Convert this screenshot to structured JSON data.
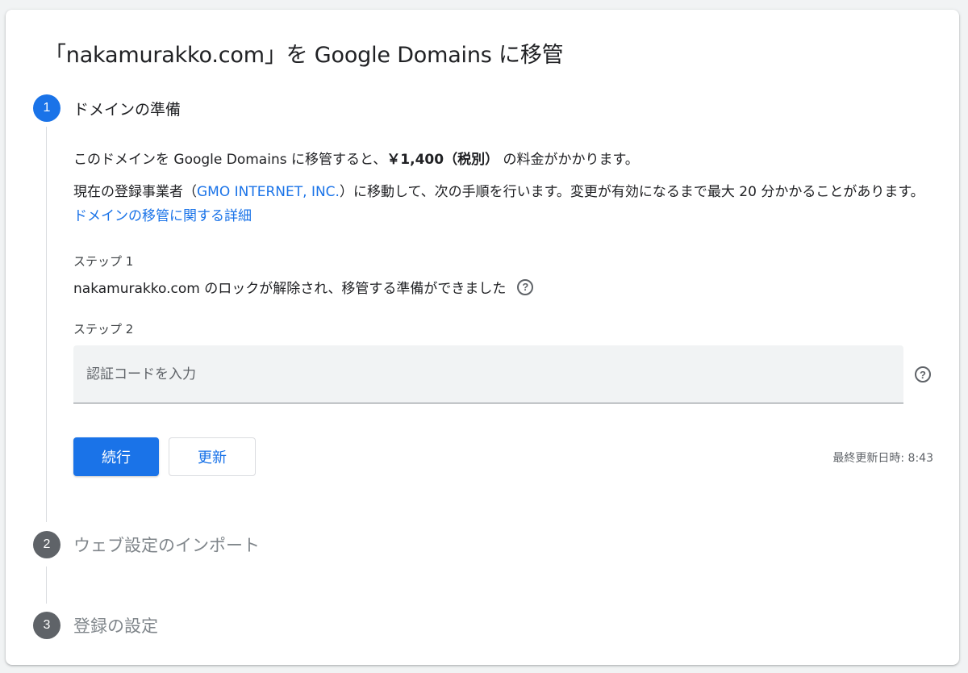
{
  "title": "「nakamurakko.com」を Google Domains に移管",
  "steps": [
    {
      "number": "1",
      "label": "ドメインの準備"
    },
    {
      "number": "2",
      "label": "ウェブ設定のインポート"
    },
    {
      "number": "3",
      "label": "登録の設定"
    }
  ],
  "intro": {
    "line1_prefix": "このドメインを Google Domains に移管すると、",
    "price": "￥1,400（税別）",
    "line1_suffix": " の料金がかかります。",
    "line2_prefix": "現在の登録事業者（",
    "registrar": "GMO INTERNET, INC.",
    "line2_suffix": "）に移動して、次の手順を行います。変更が有効になるまで最大 20 分かかることがあります。",
    "link": "ドメインの移管に関する詳細"
  },
  "substep1": {
    "label": "ステップ 1",
    "status": "nakamurakko.com のロックが解除され、移管する準備ができました"
  },
  "substep2": {
    "label": "ステップ 2",
    "input_placeholder": "認証コードを入力",
    "input_value": ""
  },
  "buttons": {
    "continue": "続行",
    "refresh": "更新"
  },
  "last_updated": "最終更新日時: 8:43",
  "help_glyph": "?",
  "colors": {
    "accent": "#1a73e8",
    "inactive": "#5f6368",
    "divider": "#dadce0"
  },
  "icons": {
    "help": "help-circle-icon"
  }
}
